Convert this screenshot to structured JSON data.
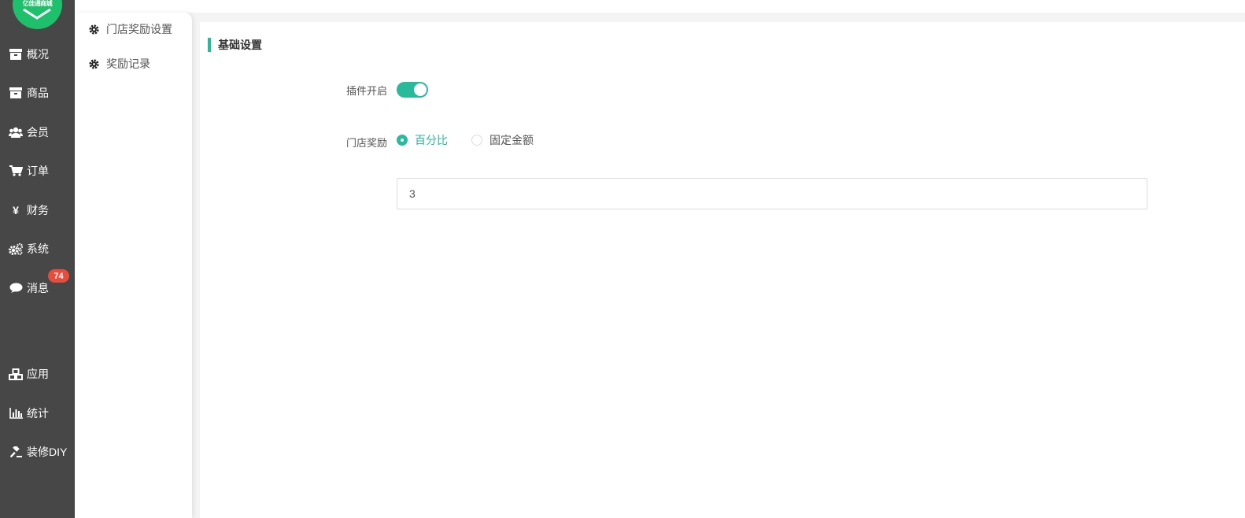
{
  "logo": {
    "text": "亿佳通商城",
    "brand_color": "#1ec06c"
  },
  "sidebar": {
    "items": [
      {
        "label": "概况",
        "icon": "archive-icon"
      },
      {
        "label": "商品",
        "icon": "archive-icon"
      },
      {
        "label": "会员",
        "icon": "users-icon"
      },
      {
        "label": "订单",
        "icon": "cart-icon"
      },
      {
        "label": "财务",
        "icon": "yen-icon"
      },
      {
        "label": "系统",
        "icon": "cogs-icon"
      },
      {
        "label": "消息",
        "icon": "comment-icon",
        "badge": "74"
      },
      {
        "label": "应用",
        "icon": "cubes-icon"
      },
      {
        "label": "统计",
        "icon": "bar-chart-icon"
      },
      {
        "label": "装修DIY",
        "icon": "gavel-icon"
      }
    ]
  },
  "subnav": {
    "items": [
      {
        "label": "门店奖励设置",
        "icon": "gear-icon"
      },
      {
        "label": "奖励记录",
        "icon": "gear-icon"
      }
    ]
  },
  "main": {
    "section_title": "基础设置",
    "plugin_enabled": {
      "label": "插件开启",
      "value": true
    },
    "store_reward": {
      "label": "门店奖励",
      "options": [
        {
          "label": "百分比",
          "checked": true
        },
        {
          "label": "固定金额",
          "checked": false
        }
      ],
      "value": "3"
    }
  },
  "colors": {
    "accent": "#29ba9c",
    "sidebar_bg": "#474747",
    "badge": "#e74c3c"
  }
}
